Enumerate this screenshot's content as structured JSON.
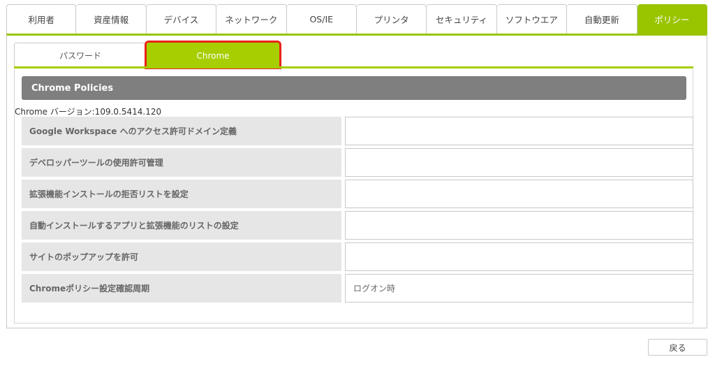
{
  "top_tabs": [
    {
      "label": "利用者"
    },
    {
      "label": "資産情報"
    },
    {
      "label": "デバイス"
    },
    {
      "label": "ネットワーク"
    },
    {
      "label": "OS/IE"
    },
    {
      "label": "プリンタ"
    },
    {
      "label": "セキュリティ"
    },
    {
      "label": "ソフトウエア"
    },
    {
      "label": "自動更新"
    },
    {
      "label": "ポリシー"
    }
  ],
  "sub_tabs": [
    {
      "label": "パスワード"
    },
    {
      "label": "Chrome"
    }
  ],
  "section": {
    "title": "Chrome Policies",
    "version_text": "Chrome バージョン:109.0.5414.120"
  },
  "rows": [
    {
      "label": "Google Workspace へのアクセス許可ドメイン定義",
      "value": ""
    },
    {
      "label": "デベロッパーツールの使用許可管理",
      "value": ""
    },
    {
      "label": "拡張機能インストールの拒否リストを設定",
      "value": ""
    },
    {
      "label": "自動インストールするアプリと拡張機能のリストの設定",
      "value": ""
    },
    {
      "label": "サイトのポップアップを許可",
      "value": ""
    },
    {
      "label": "Chromeポリシー設定確認周期",
      "value": "ログオン時"
    }
  ],
  "footer": {
    "back_label": "戻る"
  },
  "colors": {
    "active_tab": "#99c400",
    "sub_active": "#a6ce00",
    "highlight": "#e8231a",
    "header_bg": "#7f7f7f"
  }
}
